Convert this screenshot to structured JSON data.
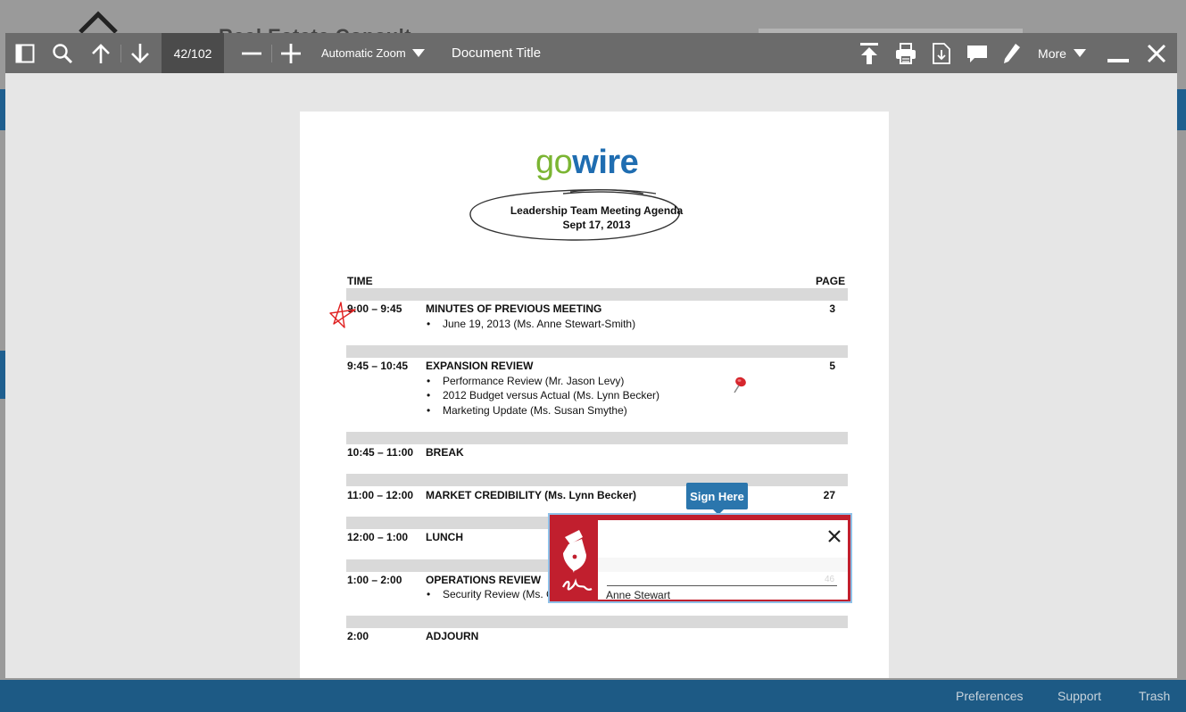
{
  "background": {
    "app_title": "Real Estate Consult",
    "footer_links": [
      "Preferences",
      "Support",
      "Trash"
    ]
  },
  "toolbar": {
    "page_indicator": "42/102",
    "zoom_label": "Automatic Zoom",
    "document_title": "Document Title",
    "more_label": "More"
  },
  "document": {
    "logo_go": "go",
    "logo_wire": "wire",
    "heading": "Leadership Team Meeting Agenda",
    "date": "Sept 17, 2013",
    "col_time": "TIME",
    "col_page": "PAGE",
    "agenda": [
      {
        "time": "9:00 – 9:45",
        "item": "MINUTES OF PREVIOUS MEETING",
        "page": "3",
        "subs": [
          "June 19, 2013 (Ms. Anne Stewart-Smith)"
        ]
      },
      {
        "time": "9:45 – 10:45",
        "item": "EXPANSION REVIEW",
        "page": "5",
        "subs": [
          "Performance Review (Mr. Jason Levy)",
          "2012 Budget versus Actual (Ms. Lynn Becker)",
          "Marketing Update (Ms. Susan Smythe)"
        ]
      },
      {
        "time": "10:45 – 11:00",
        "item": "BREAK",
        "page": "",
        "subs": []
      },
      {
        "time": "11:00 – 12:00",
        "item": "MARKET CREDIBILITY (Ms. Lynn Becker)",
        "page": "27",
        "subs": []
      },
      {
        "time": "12:00 – 1:00",
        "item": "LUNCH",
        "page": "",
        "subs": []
      },
      {
        "time": "1:00 – 2:00",
        "item": "OPERATIONS REVIEW",
        "page": "",
        "subs": [
          "Security Review (Ms. C"
        ]
      },
      {
        "time": "2:00",
        "item": "ADJOURN",
        "page": "",
        "subs": []
      }
    ]
  },
  "signature": {
    "tooltip": "Sign Here",
    "signer_name": "Anne Stewart",
    "ghost_page": "46"
  }
}
